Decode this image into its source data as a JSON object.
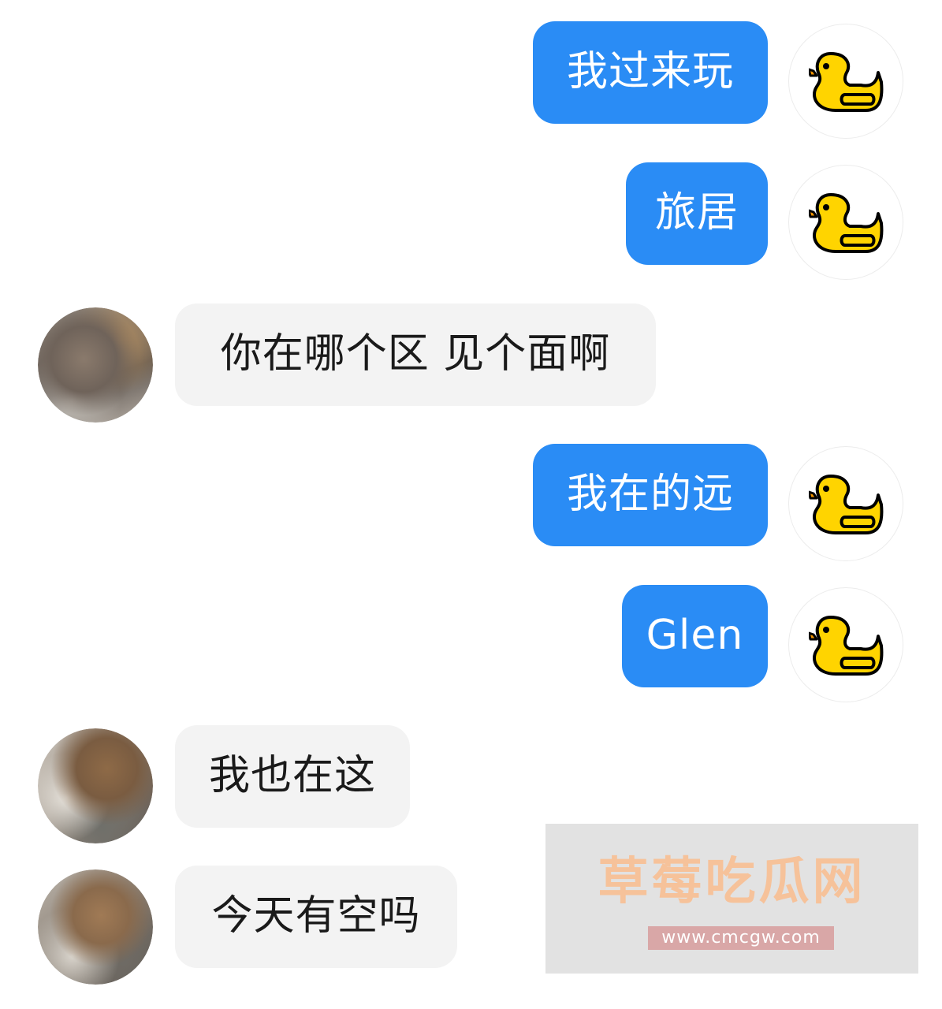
{
  "messages": [
    {
      "side": "out",
      "text": "我过来玩",
      "avatar": "duck-icon"
    },
    {
      "side": "out",
      "text": "旅居",
      "avatar": "duck-icon"
    },
    {
      "side": "in",
      "text": "你在哪个区 见个面啊",
      "avatar": "blurred-photo"
    },
    {
      "side": "out",
      "text": "我在的远",
      "avatar": "duck-icon"
    },
    {
      "side": "out",
      "text": "Glen",
      "avatar": "duck-icon"
    },
    {
      "side": "in",
      "text": "我也在这",
      "avatar": "blurred-photo"
    },
    {
      "side": "in",
      "text": "今天有空吗",
      "avatar": "blurred-photo"
    }
  ],
  "watermark": {
    "title": "草莓吃瓜网",
    "url": "www.cmcgw.com"
  },
  "colors": {
    "outgoing_bubble": "#2a8cf5",
    "incoming_bubble": "#f3f3f3",
    "duck": "#ffd400"
  }
}
